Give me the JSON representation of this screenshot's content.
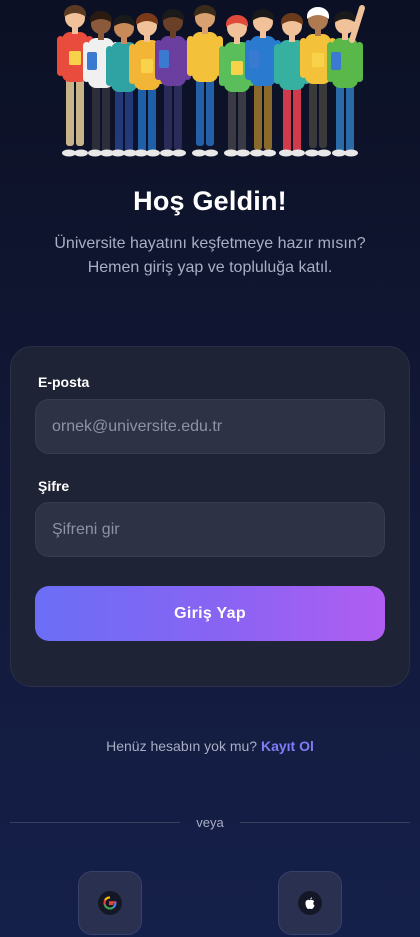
{
  "welcome": {
    "title": "Hoş Geldin!",
    "subtitle_line1": "Üniversite hayatını keşfetmeye hazır mısın?",
    "subtitle_line2": "Hemen giriş yap ve topluluğa katıl."
  },
  "form": {
    "email_label": "E-posta",
    "email_placeholder": "ornek@universite.edu.tr",
    "email_value": "",
    "password_label": "Şifre",
    "password_placeholder": "Şifreni gir",
    "password_value": "",
    "login_button": "Giriş Yap"
  },
  "signup": {
    "prompt": "Henüz hesabın yok mu?",
    "link": "Kayıt Ol"
  },
  "divider": {
    "text": "veya"
  },
  "social": {
    "google_icon": "google-icon",
    "apple_icon": "apple-icon"
  },
  "colors": {
    "background": "#111733",
    "card": "#1f2336",
    "accent_start": "#6b6ef5",
    "accent_end": "#b05ef2",
    "link": "#7f7df6"
  }
}
